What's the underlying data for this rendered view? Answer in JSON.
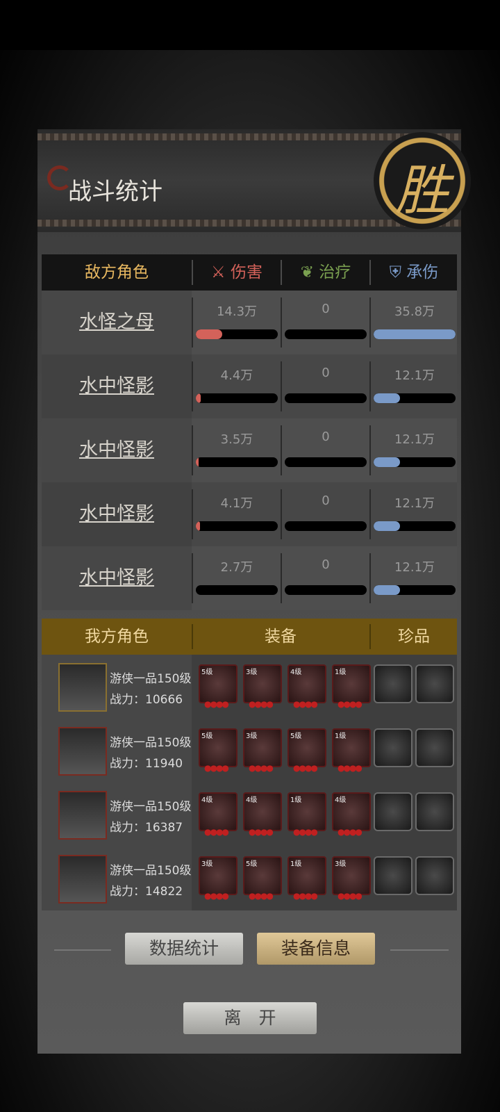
{
  "title": "战斗统计",
  "seal_char": "胜",
  "enemy_header": {
    "name": "敌方角色",
    "damage": "伤害",
    "heal": "治疗",
    "taken": "承伤"
  },
  "enemies": [
    {
      "name": "水怪之母",
      "damage": "14.3万",
      "heal": "0",
      "taken": "35.8万",
      "damage_frac": 0.32,
      "taken_frac": 1.0
    },
    {
      "name": "水中怪影",
      "damage": "4.4万",
      "heal": "0",
      "taken": "12.1万",
      "damage_frac": 0.06,
      "taken_frac": 0.32
    },
    {
      "name": "水中怪影",
      "damage": "3.5万",
      "heal": "0",
      "taken": "12.1万",
      "damage_frac": 0.03,
      "taken_frac": 0.32
    },
    {
      "name": "水中怪影",
      "damage": "4.1万",
      "heal": "0",
      "taken": "12.1万",
      "damage_frac": 0.05,
      "taken_frac": 0.32
    },
    {
      "name": "水中怪影",
      "damage": "2.7万",
      "heal": "0",
      "taken": "12.1万",
      "damage_frac": 0.0,
      "taken_frac": 0.32
    }
  ],
  "ally_header": {
    "name": "我方角色",
    "equip": "装备",
    "treasure": "珍品"
  },
  "allies": [
    {
      "title": "游侠一品150级",
      "power": "战力：10666",
      "equip_levels": [
        "5级",
        "3级",
        "4级",
        "1级"
      ]
    },
    {
      "title": "游侠一品150级",
      "power": "战力：11940",
      "equip_levels": [
        "5级",
        "3级",
        "5级",
        "1级"
      ]
    },
    {
      "title": "游侠一品150级",
      "power": "战力：16387",
      "equip_levels": [
        "4级",
        "4级",
        "1级",
        "4级"
      ]
    },
    {
      "title": "游侠一品150级",
      "power": "战力：14822",
      "equip_levels": [
        "3级",
        "5级",
        "1级",
        "3级"
      ]
    }
  ],
  "buttons": {
    "stats": "数据统计",
    "equip_info": "装备信息",
    "leave": "离　开"
  },
  "colors": {
    "damage": "#d4625a",
    "heal": "#7aa050",
    "taken": "#7a9ac8",
    "gold": "#e8b860"
  }
}
